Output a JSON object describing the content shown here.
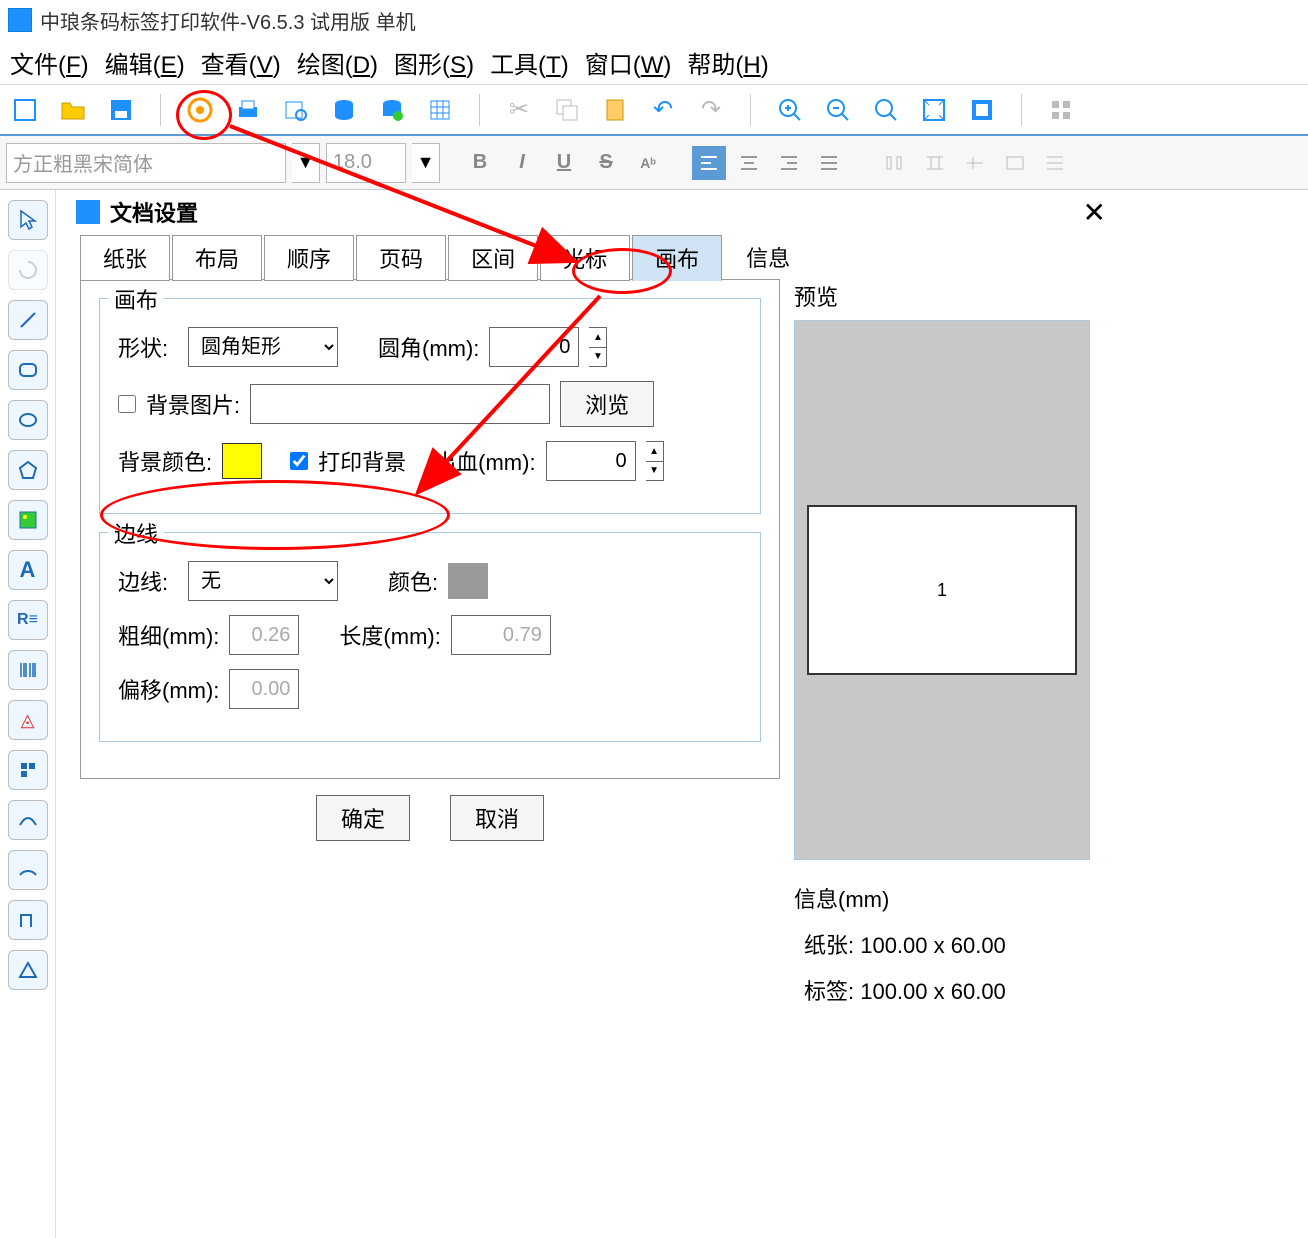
{
  "title": "中琅条码标签打印软件-V6.5.3 试用版 单机",
  "menu": {
    "file": "文件(",
    "file_k": "F",
    "file_c": ")",
    "edit": "编辑(",
    "edit_k": "E",
    "view": "查看(",
    "view_k": "V",
    "draw": "绘图(",
    "draw_k": "D",
    "shape": "图形(",
    "shape_k": "S",
    "tool": "工具(",
    "tool_k": "T",
    "window": "窗口(",
    "window_k": "W",
    "help": "帮助(",
    "help_k": "H"
  },
  "font": {
    "name": "方正粗黑宋简体",
    "size": "18.0"
  },
  "dialog": {
    "title": "文档设置",
    "tabs": {
      "paper": "纸张",
      "layout": "布局",
      "order": "顺序",
      "page": "页码",
      "range": "区间",
      "cursor": "光标",
      "canvas": "画布",
      "info": "信息"
    },
    "canvas_group": "画布",
    "shape_label": "形状:",
    "shape_value": "圆角矩形",
    "corner_label": "圆角(mm):",
    "corner_value": "0",
    "bgimg_label": "背景图片:",
    "browse": "浏览",
    "bgcolor_label": "背景颜色:",
    "print_bg": "打印背景",
    "bleed_label": "出血(mm):",
    "bleed_value": "0",
    "border_group": "边线",
    "border_label": "边线:",
    "border_value": "无",
    "color_label": "颜色:",
    "thick_label": "粗细(mm):",
    "thick_value": "0.26",
    "length_label": "长度(mm):",
    "length_value": "0.79",
    "offset_label": "偏移(mm):",
    "offset_value": "0.00",
    "preview": "预览",
    "preview_num": "1",
    "info_title": "信息(mm)",
    "paper_info": "纸张: 100.00 x 60.00",
    "label_info": "标签: 100.00 x 60.00",
    "ok": "确定",
    "cancel": "取消"
  }
}
